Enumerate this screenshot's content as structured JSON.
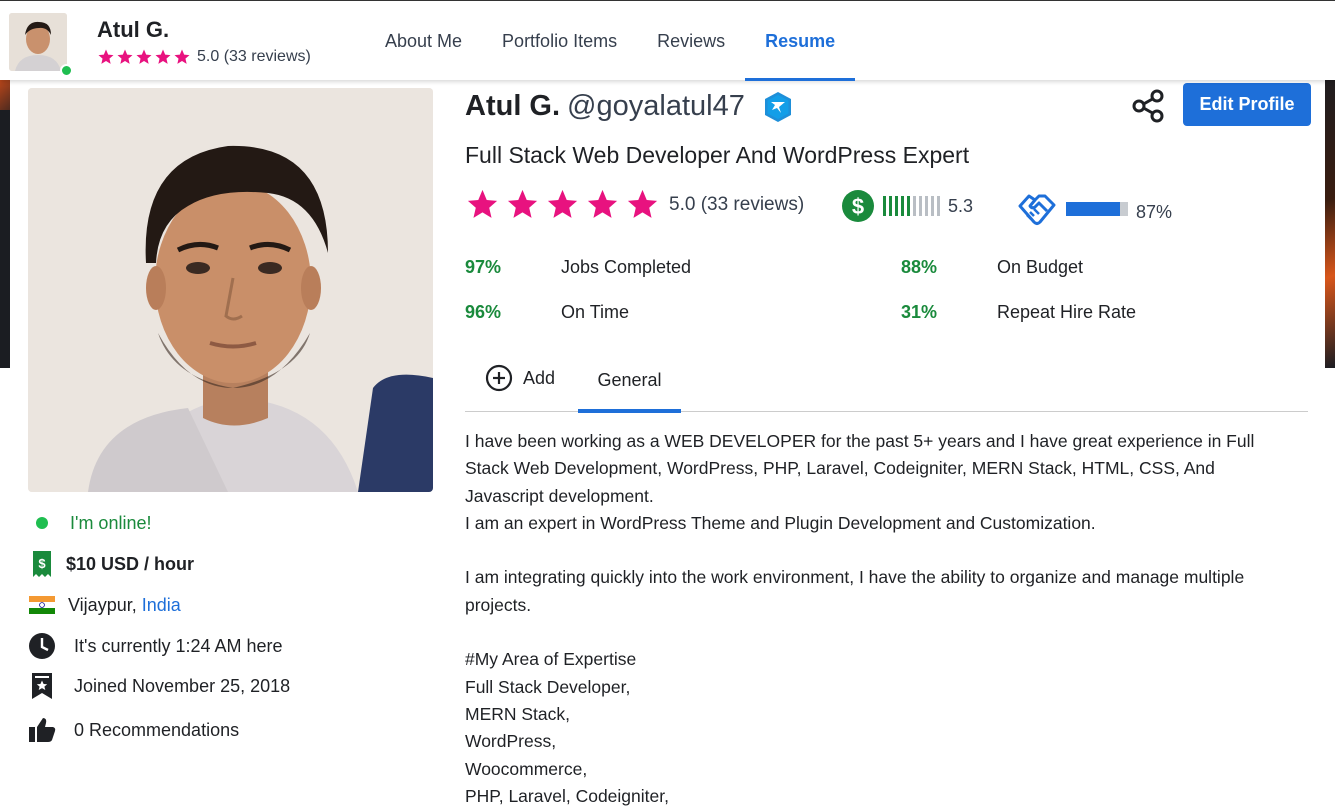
{
  "header": {
    "name": "Atul G.",
    "rating_text": "5.0 (33 reviews)",
    "stars": 5
  },
  "nav": [
    {
      "label": "About Me",
      "active": false
    },
    {
      "label": "Portfolio Items",
      "active": false
    },
    {
      "label": "Reviews",
      "active": false
    },
    {
      "label": "Resume",
      "active": true
    }
  ],
  "profile": {
    "name": "Atul G.",
    "handle": "@goyalatul47",
    "tagline": "Full Stack Web Developer And WordPress Expert",
    "rating_text": "5.0 (33 reviews)",
    "stars": 5,
    "earnings_score": "5.3",
    "earnings_level": 5.3,
    "earnings_bars_total": 10,
    "completion_percent_text": "87%",
    "completion_fraction": 0.87,
    "edit_label": "Edit Profile"
  },
  "stats": [
    {
      "pct": "97%",
      "label": "Jobs Completed"
    },
    {
      "pct": "88%",
      "label": "On Budget"
    },
    {
      "pct": "96%",
      "label": "On Time"
    },
    {
      "pct": "31%",
      "label": "Repeat Hire Rate"
    }
  ],
  "tabs": {
    "add_label": "Add",
    "general_label": "General"
  },
  "sidebar": {
    "online": "I'm online!",
    "rate": "$10 USD / hour",
    "city": "Vijaypur,",
    "country": "India",
    "time": "It's currently 1:24 AM here",
    "joined": "Joined November 25, 2018",
    "recommendations": "0 Recommendations"
  },
  "description": {
    "line1": "I have been working as a WEB DEVELOPER for the past 5+ years and I have great experience in Full",
    "line2": "Stack Web Development, WordPress, PHP, Laravel, Codeigniter, MERN Stack, HTML, CSS, And",
    "line3": "Javascript development.",
    "line4": "I am an expert in WordPress Theme and Plugin Development and Customization.",
    "line5": "I am integrating quickly into the work environment, I have the ability to organize and manage multiple",
    "line6": "projects.",
    "line7": "#My Area of Expertise",
    "line8": "Full Stack Developer,",
    "line9": "MERN Stack,",
    "line10": "WordPress,",
    "line11": "Woocommerce,",
    "line12": "PHP, Laravel, Codeigniter,"
  },
  "colors": {
    "accent": "#1e6fd9",
    "star": "#e8127f",
    "success": "#1a8a3c",
    "online": "#1fbe50"
  }
}
